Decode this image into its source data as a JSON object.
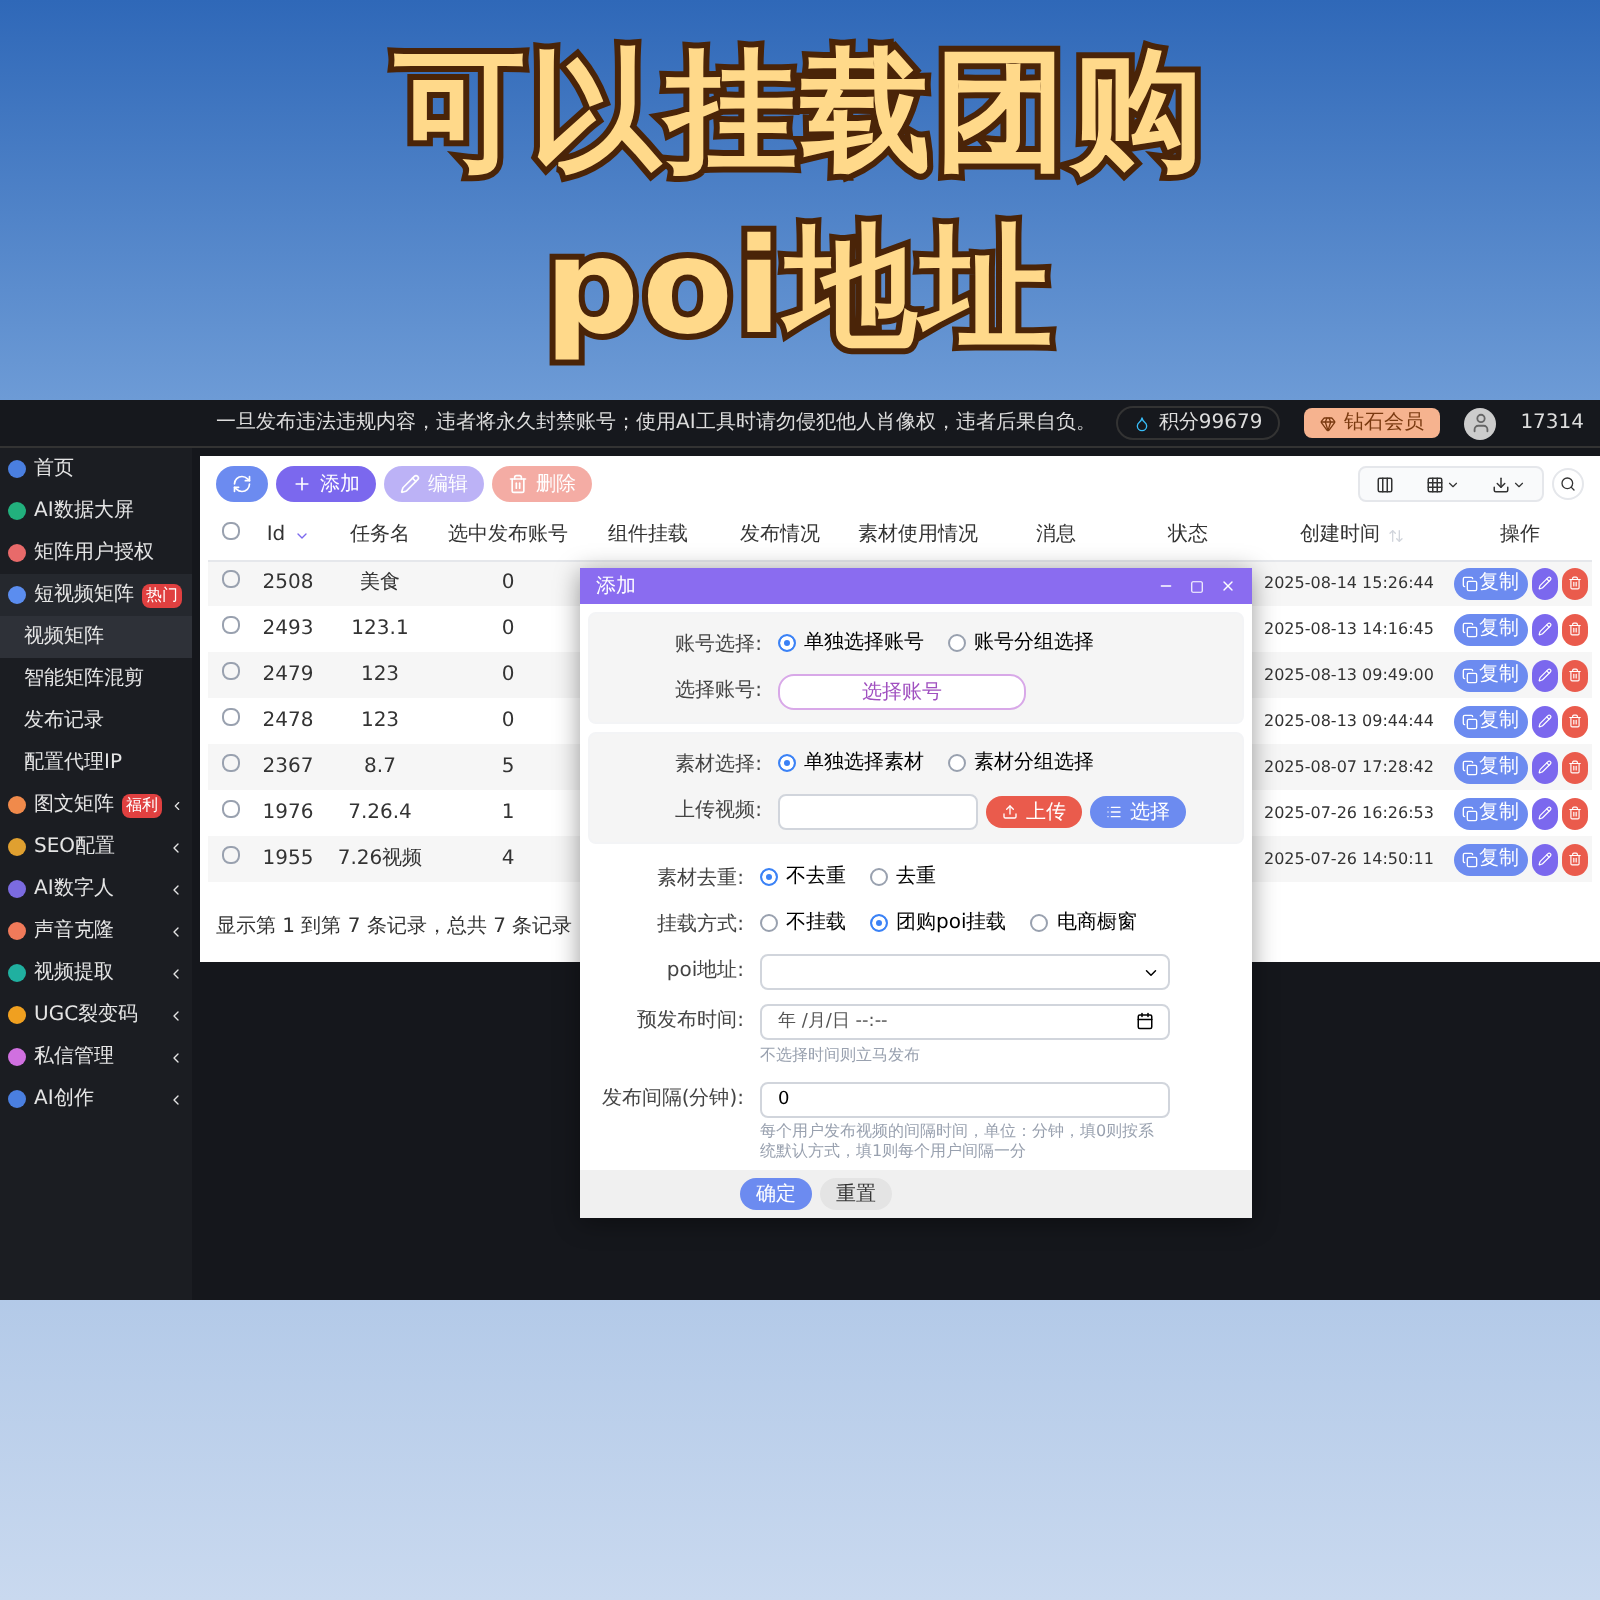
{
  "headline": {
    "lines": [
      "可以挂载团购",
      "poi地址"
    ]
  },
  "topbar": {
    "notice": "一旦发布违法违规内容，违者将永久封禁账号；使用AI工具时请勿侵犯他人肖像权，违者后果自负。",
    "points": "积分99679",
    "member": "钻石会员",
    "user": "17314"
  },
  "sidebar": {
    "items": [
      {
        "label": "首页",
        "color": "#4a7fe0",
        "selected": false
      },
      {
        "label": "AI数据大屏",
        "color": "#22b07d",
        "selected": false
      },
      {
        "label": "矩阵用户授权",
        "color": "#e86a6a",
        "selected": false
      },
      {
        "label": "短视频矩阵",
        "color": "#5b8def",
        "selected": false,
        "badge": "热门",
        "expanded": true,
        "children": [
          {
            "label": "视频矩阵",
            "selected": true
          },
          {
            "label": "智能矩阵混剪",
            "selected": false
          },
          {
            "label": "发布记录",
            "selected": false
          },
          {
            "label": "配置代理IP",
            "selected": false
          }
        ]
      },
      {
        "label": "图文矩阵",
        "color": "#f08a4b",
        "selected": false,
        "badge": "福利",
        "expanded": false
      },
      {
        "label": "SEO配置",
        "color": "#e0a030",
        "selected": false,
        "expanded": false
      },
      {
        "label": "AI数字人",
        "color": "#7b6be0",
        "selected": false,
        "expanded": false
      },
      {
        "label": "声音克隆",
        "color": "#f07a5a",
        "selected": false,
        "expanded": false
      },
      {
        "label": "视频提取",
        "color": "#20b0a0",
        "selected": false,
        "expanded": false
      },
      {
        "label": "UGC裂变码",
        "color": "#f0a020",
        "selected": false,
        "expanded": false
      },
      {
        "label": "私信管理",
        "color": "#d070e0",
        "selected": false,
        "expanded": false
      },
      {
        "label": "AI创作",
        "color": "#4a7fe0",
        "selected": false,
        "expanded": false
      }
    ]
  },
  "toolbar": {
    "buttons": [
      {
        "kind": "refresh",
        "disabled": false
      },
      {
        "kind": "add",
        "label": "添加",
        "disabled": false
      },
      {
        "kind": "edit",
        "label": "编辑",
        "disabled": true
      },
      {
        "kind": "delete",
        "label": "删除",
        "disabled": true
      }
    ]
  },
  "table": {
    "header_checked": false,
    "columns": [
      {
        "label": "Id",
        "sorted": true
      },
      {
        "label": "任务名"
      },
      {
        "label": "选中发布账号"
      },
      {
        "label": "组件挂载"
      },
      {
        "label": "发布情况"
      },
      {
        "label": "素材使用情况"
      },
      {
        "label": "消息"
      },
      {
        "label": "状态"
      },
      {
        "label": "创建时间",
        "sorted": false
      },
      {
        "label": "操作"
      }
    ],
    "rows": [
      {
        "checked": false,
        "id": "2508",
        "name": "美食",
        "accounts": "0",
        "created": "2025-08-14 15:26:44",
        "copy": "复制"
      },
      {
        "checked": false,
        "id": "2493",
        "name": "123.1",
        "accounts": "0",
        "created": "2025-08-13 14:16:45",
        "copy": "复制"
      },
      {
        "checked": false,
        "id": "2479",
        "name": "123",
        "accounts": "0",
        "created": "2025-08-13 09:49:00",
        "copy": "复制"
      },
      {
        "checked": false,
        "id": "2478",
        "name": "123",
        "accounts": "0",
        "created": "2025-08-13 09:44:44",
        "copy": "复制"
      },
      {
        "checked": false,
        "id": "2367",
        "name": "8.7",
        "accounts": "5",
        "created": "2025-08-07 17:28:42",
        "copy": "复制"
      },
      {
        "checked": false,
        "id": "1976",
        "name": "7.26.4",
        "accounts": "1",
        "created": "2025-07-26 16:26:53",
        "copy": "复制"
      },
      {
        "checked": false,
        "id": "1955",
        "name": "7.26视频",
        "accounts": "4",
        "created": "2025-07-26 14:50:11",
        "copy": "复制"
      }
    ]
  },
  "pagination": "显示第 1 到第 7 条记录，总共 7 条记录",
  "dialog": {
    "title": "添加",
    "sections": [
      {
        "rows": [
          {
            "kind": "radio",
            "label": "账号选择:",
            "options": [
              {
                "label": "单独选择账号",
                "selected": true
              },
              {
                "label": "账号分组选择",
                "selected": false
              }
            ]
          },
          {
            "kind": "picker",
            "label": "选择账号:",
            "button": "选择账号"
          }
        ]
      },
      {
        "rows": [
          {
            "kind": "radio",
            "label": "素材选择:",
            "options": [
              {
                "label": "单独选择素材",
                "selected": true
              },
              {
                "label": "素材分组选择",
                "selected": false
              }
            ]
          },
          {
            "kind": "upload",
            "label": "上传视频:",
            "upload": "上传",
            "choose": "选择"
          }
        ]
      }
    ],
    "fields": [
      {
        "kind": "radio",
        "label": "素材去重:",
        "options": [
          {
            "label": "不去重",
            "selected": true
          },
          {
            "label": "去重",
            "selected": false
          }
        ]
      },
      {
        "kind": "radio",
        "label": "挂载方式:",
        "options": [
          {
            "label": "不挂载",
            "selected": false
          },
          {
            "label": "团购poi挂载",
            "selected": true
          },
          {
            "label": "电商橱窗",
            "selected": false
          }
        ]
      },
      {
        "kind": "select",
        "label": "poi地址:"
      },
      {
        "kind": "datetime",
        "label": "预发布时间:",
        "placeholder": "年 /月/日 --:--",
        "hint": "不选择时间则立马发布"
      },
      {
        "kind": "text",
        "label": "发布间隔(分钟):",
        "value": "0",
        "hint": "每个用户发布视频的间隔时间，单位：分钟，填0则按系统默认方式，填1则每个用户间隔一分"
      }
    ],
    "buttons": [
      {
        "kind": "primary",
        "label": "确定"
      },
      {
        "kind": "default",
        "label": "重置"
      }
    ]
  }
}
